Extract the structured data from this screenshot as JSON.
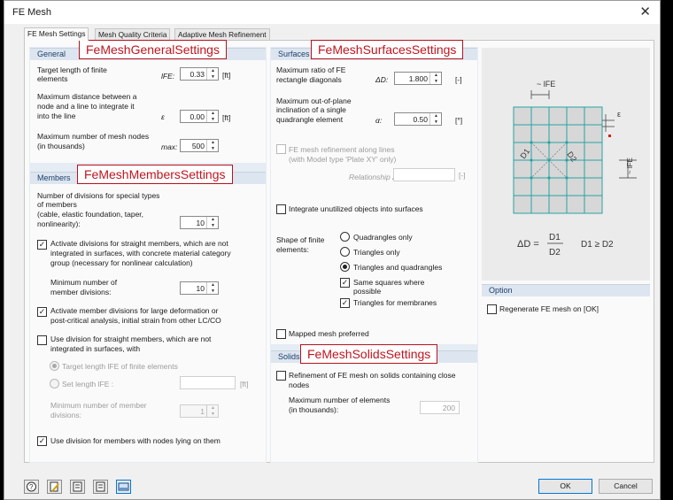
{
  "window": {
    "title": "FE Mesh",
    "close_glyph": "✕"
  },
  "tabs": [
    "FE Mesh Settings",
    "Mesh Quality Criteria",
    "Adaptive Mesh Refinement"
  ],
  "callouts": {
    "general": "FeMeshGeneralSettings",
    "surfaces": "FeMeshSurfacesSettings",
    "members": "FeMeshMembersSettings",
    "solids": "FeMeshSolidsSettings"
  },
  "general": {
    "header": "General",
    "target_length": {
      "label1": "Target length of finite",
      "label2": "elements",
      "symbol": "lFE:",
      "value": "0.33",
      "unit": "[ft]"
    },
    "max_distance": {
      "label1": "Maximum distance between a",
      "label2": "node and a line to integrate it",
      "label3": "into the line",
      "symbol": "ε",
      "value": "0.00",
      "unit": "[ft]"
    },
    "max_nodes": {
      "label1": "Maximum number of mesh nodes",
      "label2": "(in thousands)",
      "symbol": "max:",
      "value": "500"
    }
  },
  "members": {
    "header": "Members",
    "divisions": {
      "label1": "Number of divisions for special types",
      "label2": "of members",
      "label3": "(cable, elastic foundation, taper,",
      "label4": "nonlinearity):",
      "value": "10"
    },
    "activate_straight": {
      "checked": true,
      "label1": "Activate divisions for straight members, which are not",
      "label2": "integrated in surfaces, with concrete material category",
      "label3": "group (necessary for nonlinear calculation)"
    },
    "min_divisions": {
      "label1": "Minimum number of",
      "label2": "member divisions:",
      "value": "10"
    },
    "activate_large": {
      "checked": true,
      "label1": "Activate member divisions for large deformation or",
      "label2": "post-critical analysis, initial strain from other LC/CO"
    },
    "use_division": {
      "checked": false,
      "label1": "Use division for straight members, which are not",
      "label2": "integrated in surfaces, with"
    },
    "radio_target": "Target length lFE of finite elements",
    "radio_set": "Set length lFE :",
    "set_unit": "[ft]",
    "min_divisions_disabled": {
      "label1": "Minimum number of member",
      "label2": "divisions:",
      "value": "1"
    },
    "nodes_on_them": {
      "checked": true,
      "label": "Use division for members with nodes lying on them"
    }
  },
  "surfaces": {
    "header": "Surfaces",
    "max_ratio": {
      "label1": "Maximum ratio of FE",
      "label2": "rectangle diagonals",
      "symbol": "ΔD:",
      "value": "1.800",
      "unit": "[-]"
    },
    "max_out_of_plane": {
      "label1": "Maximum out-of-plane",
      "label2": "inclination of a single",
      "label3": "quadrangle element",
      "symbol": "α:",
      "value": "0.50",
      "unit": "[°]"
    },
    "refinement_lines": {
      "checked": false,
      "label1": "FE mesh refinement along lines",
      "label2": "(with Model type 'Plate XY' only)"
    },
    "relationship": {
      "label": "Relationship Δb:",
      "unit": "[-]"
    },
    "integrate_unutilized": {
      "checked": false,
      "label": "Integrate unutilized objects into surfaces"
    },
    "shape_label1": "Shape of finite",
    "shape_label2": "elements:",
    "shapes": [
      {
        "label": "Quadrangles only",
        "selected": false
      },
      {
        "label": "Triangles only",
        "selected": false
      },
      {
        "label": "Triangles and quadrangles",
        "selected": true
      }
    ],
    "same_squares": {
      "checked": true,
      "label1": "Same squares where",
      "label2": "possible"
    },
    "triangles_membranes": {
      "checked": true,
      "label": "Triangles for membranes"
    },
    "mapped_mesh": {
      "checked": false,
      "label": "Mapped mesh preferred"
    }
  },
  "solids": {
    "header": "Solids",
    "refinement": {
      "checked": false,
      "label1": "Refinement of FE mesh on solids containing close",
      "label2": "nodes"
    },
    "max_elements": {
      "label1": "Maximum number of elements",
      "label2": "(in thousands):",
      "value": "200"
    }
  },
  "diagram": {
    "lfe_top": "~ lFE",
    "lfe_side": "~ lFE",
    "epsilon": "ε",
    "d1": "D1",
    "d2": "D2",
    "formula_lhs": "ΔD =",
    "formula_num": "D1",
    "formula_den": "D2",
    "formula_cond": "D1 ≥ D2",
    "grid_color": "#2aa3a3"
  },
  "option": {
    "header": "Option",
    "regenerate": {
      "checked": false,
      "label": "Regenerate FE mesh on [OK]"
    }
  },
  "footer": {
    "ok": "OK",
    "cancel": "Cancel"
  },
  "footer_icons": [
    "help-icon",
    "edit-icon",
    "import-icon",
    "export-icon",
    "units-icon"
  ]
}
